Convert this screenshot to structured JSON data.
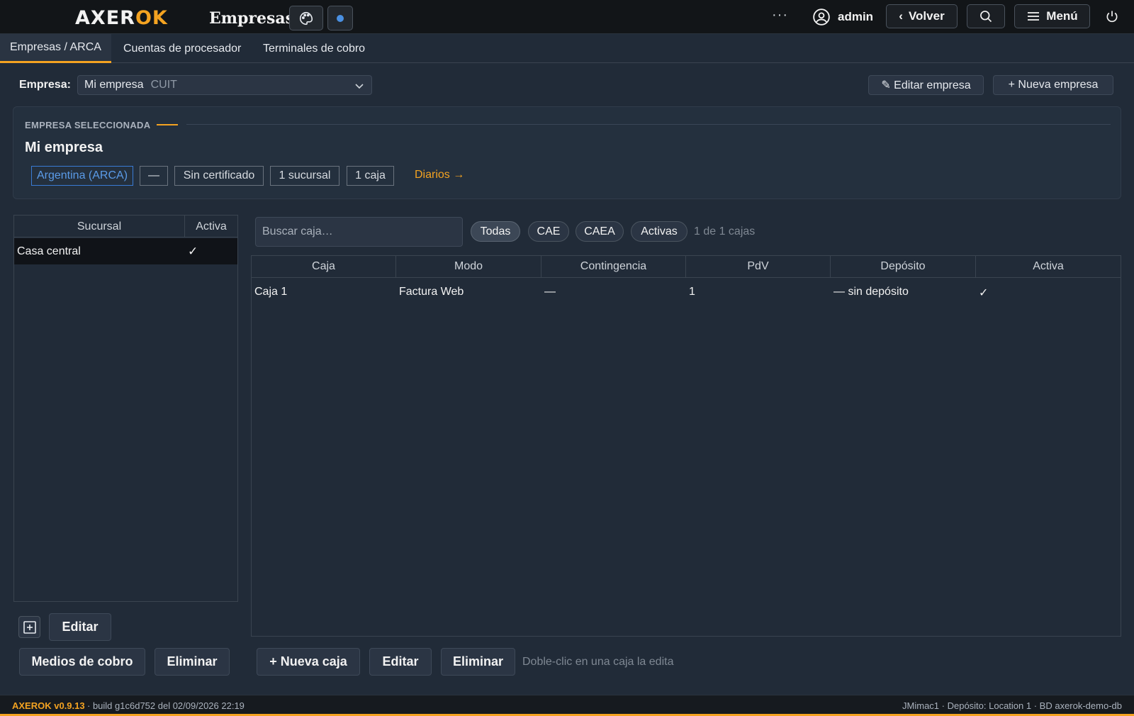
{
  "app": {
    "logo_main": "AXER",
    "logo_accent": "OK",
    "title": "Empresas",
    "accent_color": "#f4a321"
  },
  "topbar": {
    "more_label": "···",
    "user_name": "admin",
    "back_label": "Volver",
    "menu_label": "Menú",
    "icons": [
      "palette-icon",
      "dot-icon",
      "user-circle-icon",
      "chevron-left-icon",
      "search-icon",
      "hamburger-icon",
      "power-icon"
    ]
  },
  "tabs": [
    {
      "label": "Empresas / ARCA",
      "active": true
    },
    {
      "label": "Cuentas de procesador",
      "active": false
    },
    {
      "label": "Terminales de cobro",
      "active": false
    }
  ],
  "empresa_select": {
    "label": "Empresa:",
    "value": "Mi empresa",
    "sub": "CUIT",
    "edit_label": "✎ Editar empresa",
    "new_label": "+ Nueva empresa"
  },
  "selected": {
    "heading": "EMPRESA SELECCIONADA",
    "name": "Mi empresa",
    "chips": [
      "Argentina (ARCA)",
      "—",
      "Sin certificado",
      "1 sucursal",
      "1 caja"
    ],
    "diarios_label": "Diarios →"
  },
  "sucursales": {
    "columns": [
      "Sucursal",
      "Activa"
    ],
    "rows": [
      {
        "name": "Casa central",
        "active": "✓"
      }
    ],
    "edit_label": "Editar",
    "medios_label": "Medios de cobro",
    "delete_label": "Eliminar"
  },
  "cajas": {
    "search_placeholder": "Buscar caja…",
    "filters": [
      "Todas",
      "CAE",
      "CAEA",
      "Activas"
    ],
    "active_filter": "Todas",
    "count_text": "1 de 1 cajas",
    "columns": [
      "Caja",
      "Modo",
      "Contingencia",
      "PdV",
      "Depósito",
      "Activa"
    ],
    "rows": [
      {
        "caja": "Caja 1",
        "modo": "Factura Web",
        "contingencia": "—",
        "pdv": "1",
        "deposito": "— sin depósito",
        "activa": "✓"
      }
    ],
    "new_label": "+ Nueva caja",
    "edit_label": "Editar",
    "delete_label": "Eliminar",
    "hint": "Doble-clic en una caja la edita"
  },
  "footer": {
    "version": "AXEROK v0.9.13",
    "build": "· build g1c6d752 del 02/09/2026 22:19",
    "right": "JMimac1 · Depósito: Location 1 · BD axerok-demo-db"
  }
}
